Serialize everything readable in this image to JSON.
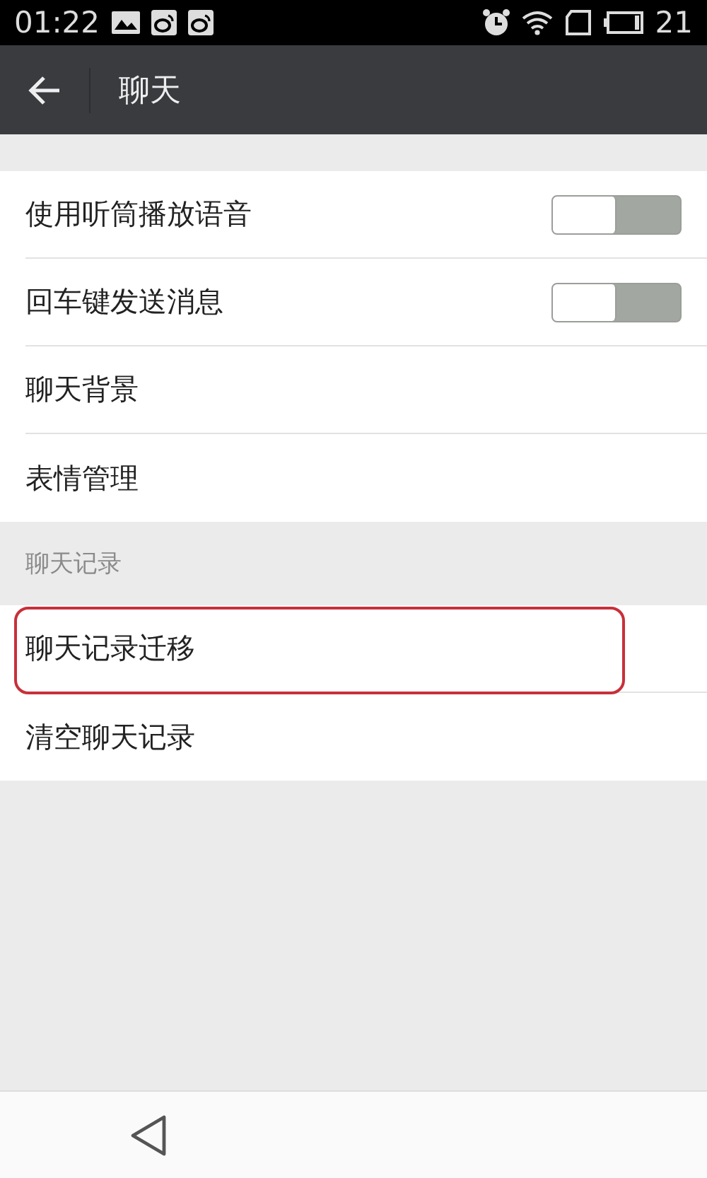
{
  "status_bar": {
    "time": "01:22",
    "battery": "21"
  },
  "toolbar": {
    "title": "聊天"
  },
  "groups": [
    {
      "items": [
        {
          "label": "使用听筒播放语音",
          "kind": "toggle",
          "on": false,
          "highlighted": false
        },
        {
          "label": "回车键发送消息",
          "kind": "toggle",
          "on": false,
          "highlighted": false
        },
        {
          "label": "聊天背景",
          "kind": "link",
          "highlighted": false
        },
        {
          "label": "表情管理",
          "kind": "link",
          "highlighted": false
        }
      ]
    },
    {
      "header": "聊天记录",
      "items": [
        {
          "label": "聊天记录迁移",
          "kind": "link",
          "highlighted": true
        },
        {
          "label": "清空聊天记录",
          "kind": "link",
          "highlighted": false
        }
      ]
    }
  ]
}
